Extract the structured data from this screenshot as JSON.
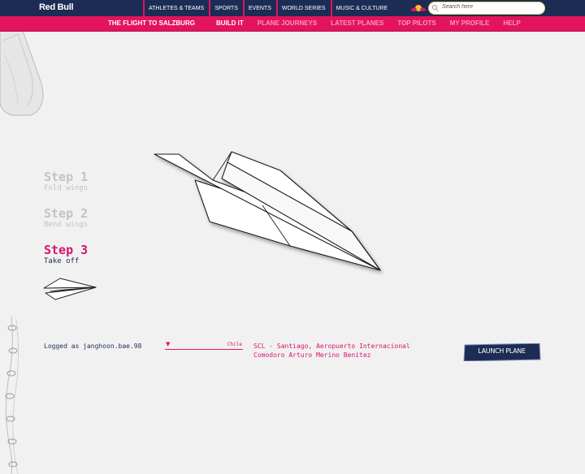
{
  "brand": {
    "logo_text": "Red Bull"
  },
  "top_nav": [
    "ATHLETES & TEAMS",
    "SPORTS",
    "EVENTS",
    "WORLD SERIES",
    "MUSIC & CULTURE"
  ],
  "search": {
    "placeholder": "Search here"
  },
  "section": {
    "title": "THE FLIGHT TO SALZBURG"
  },
  "sub_nav": [
    "BUILD IT",
    "PLANE JOURNEYS",
    "LATEST PLANES",
    "TOP PILOTS",
    "MY PROFILE",
    "HELP"
  ],
  "steps": [
    {
      "number": "Step 1",
      "label": "Fold wings"
    },
    {
      "number": "Step 2",
      "label": "Bend wings"
    },
    {
      "number": "Step 3",
      "label": "Take off"
    }
  ],
  "footer": {
    "logged_as": "Logged as janghoon.bae.98",
    "country": "Chile",
    "airport_line1": "SCL - Santiago, Aeropuerto Internacional",
    "airport_line2": "Comodoro Arturo Merino Benitez",
    "launch_label": "LAUNCH PLANE"
  },
  "colors": {
    "navy": "#1c2c55",
    "pink": "#e3145c",
    "magenta_text": "#d9136e",
    "background": "#f1f1f1"
  }
}
